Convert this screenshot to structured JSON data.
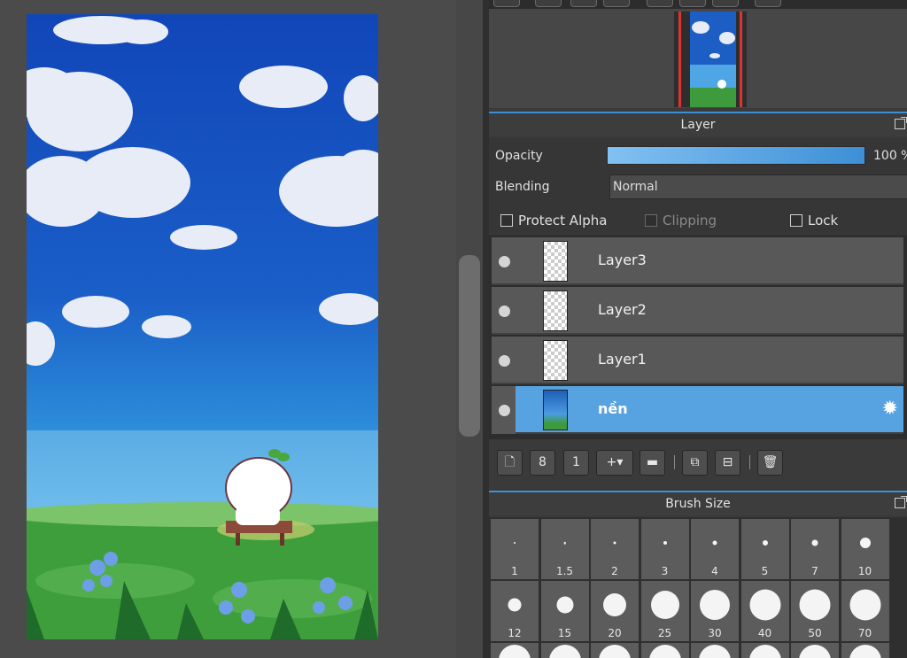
{
  "navigator": {
    "toolbar_buttons": [
      "nav-button-1",
      "nav-button-2",
      "nav-button-3",
      "nav-button-4",
      "nav-button-5",
      "nav-button-6",
      "nav-button-7",
      "nav-button-8"
    ]
  },
  "layer_panel": {
    "title": "Layer",
    "opacity_label": "Opacity",
    "opacity_value": "100 %",
    "opacity_fraction": 1.0,
    "blending_label": "Blending",
    "blending_value": "Normal",
    "protect_alpha": "Protect Alpha",
    "clipping": "Clipping",
    "lock": "Lock",
    "accent_color": "#3d8fd6"
  },
  "layers": [
    {
      "name": "Layer3",
      "selected": false
    },
    {
      "name": "Layer2",
      "selected": false
    },
    {
      "name": "Layer1",
      "selected": false
    },
    {
      "name": "nền",
      "selected": true
    }
  ],
  "layer_toolbar": [
    "new-layer-icon",
    "new-8bit-layer-icon",
    "new-1bit-layer-icon",
    "add-layer-menu-icon",
    "folder-icon",
    "duplicate-icon",
    "merge-down-icon",
    "delete-icon"
  ],
  "brush_size_panel": {
    "title": "Brush Size",
    "sizes": [
      "1",
      "1.5",
      "2",
      "3",
      "4",
      "5",
      "7",
      "10",
      "12",
      "15",
      "20",
      "25",
      "30",
      "40",
      "50",
      "70"
    ]
  }
}
